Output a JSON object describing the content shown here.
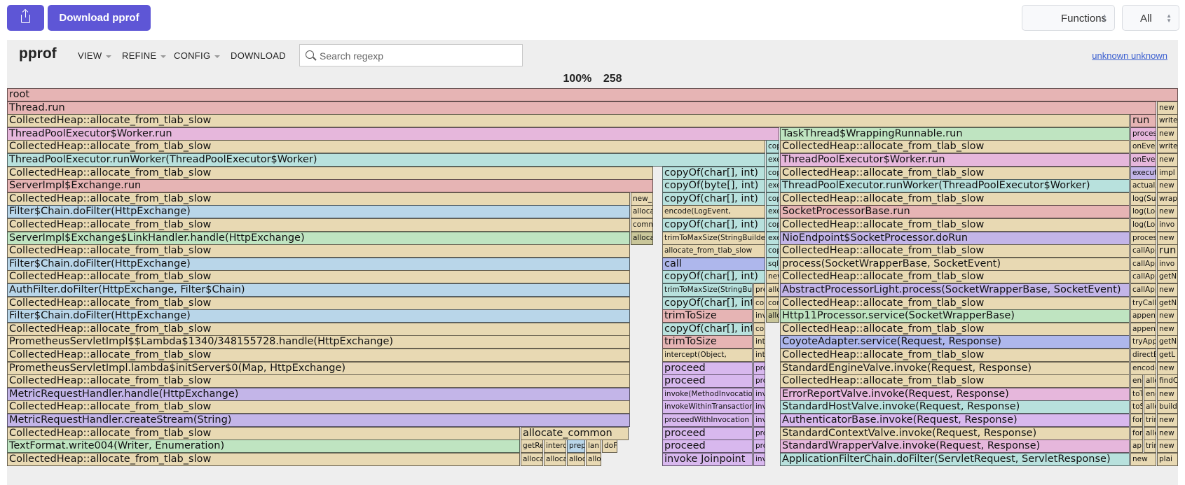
{
  "toolbar": {
    "download_label": "Download pprof",
    "view_select": "Functions",
    "scope_select": "All"
  },
  "header": {
    "logo": "pprof",
    "menu": [
      "VIEW",
      "REFINE",
      "CONFIG",
      "DOWNLOAD"
    ],
    "search_placeholder": "Search regexp",
    "user": "unknown unknown"
  },
  "summary": {
    "percent": "100%",
    "total": "258"
  },
  "flame": [
    [
      "root"
    ],
    [
      "Thread.run",
      "new"
    ],
    [
      "CollectedHeap::allocate_from_tlab_slow",
      "run",
      "write"
    ],
    [
      "ThreadPoolExecutor$Worker.run",
      "TaskThread$WrappingRunnable.run",
      "process",
      "new"
    ],
    [
      "CollectedHeap::allocate_from_tlab_slow",
      "cop",
      "CollectedHeap::allocate_from_tlab_slow",
      "onEvent",
      "write"
    ],
    [
      "ThreadPoolExecutor.runWorker(ThreadPoolExecutor$Worker)",
      "exe",
      "ThreadPoolExecutor$Worker.run",
      "onEvent",
      "new"
    ],
    [
      "CollectedHeap::allocate_from_tlab_slow",
      "copyOf(char[], int)",
      "cop",
      "CollectedHeap::allocate_from_tlab_slow",
      "execute",
      "impl"
    ],
    [
      "ServerImpl$Exchange.run",
      "copyOf(byte[], int)",
      "exe",
      "ThreadPoolExecutor.runWorker(ThreadPoolExecutor$Worker)",
      "actualAppend",
      "new"
    ],
    [
      "CollectedHeap::allocate_from_tlab_slow",
      "new_",
      "copyOf(char[], int)",
      "cop",
      "CollectedHeap::allocate_from_tlab_slow",
      "log(Supplier)",
      "wrap"
    ],
    [
      "Filter$Chain.doFilter(HttpExchange)",
      "allocate",
      "encode(LogEvent,",
      "exe",
      "SocketProcessorBase.run",
      "log(Logger)",
      "new"
    ],
    [
      "CollectedHeap::allocate_from_tlab_slow",
      "comm",
      "copyOf(char[], int)",
      "cop",
      "CollectedHeap::allocate_from_tlab_slow",
      "log(Logger)",
      "invo"
    ],
    [
      "ServerImpl$Exchange$LinkHandler.handle(HttpExchange)",
      "allocate",
      "trimToMaxSize(StringBuilder)",
      "exe",
      "NioEndpoint$SocketProcessor.doRun",
      "process",
      "new"
    ],
    [
      "CollectedHeap::allocate_from_tlab_slow",
      "allocate_from_tlab_slow",
      "cop",
      "CollectedHeap::allocate_from_tlab_slow",
      "callAppender",
      "run"
    ],
    [
      "Filter$Chain.doFilter(HttpExchange)",
      "call",
      "sql",
      "process(SocketWrapperBase, SocketEvent)",
      "callAppender",
      "invo"
    ],
    [
      "CollectedHeap::allocate_from_tlab_slow",
      "copyOf(char[], int)",
      "new",
      "CollectedHeap::allocate_from_tlab_slow",
      "callAppender",
      "getN"
    ],
    [
      "AuthFilter.doFilter(HttpExchange, Filter$Chain)",
      "trimToMaxSize(StringBuilder)",
      "pre",
      "allo",
      "AbstractProcessorLight.process(SocketWrapperBase, SocketEvent)",
      "callAppender",
      "new"
    ],
    [
      "CollectedHeap::allocate_from_tlab_slow",
      "copyOf(char[], int)",
      "cop",
      "com",
      "CollectedHeap::allocate_from_tlab_slow",
      "tryCallAppender",
      "getN"
    ],
    [
      "Filter$Chain.doFilter(HttpExchange)",
      "trimToSize",
      "inv",
      "allo",
      "Http11Processor.service(SocketWrapperBase)",
      "append",
      "new"
    ],
    [
      "CollectedHeap::allocate_from_tlab_slow",
      "copyOf(char[], int)",
      "cop",
      "CollectedHeap::allocate_from_tlab_slow",
      "append",
      "new"
    ],
    [
      "PrometheusServletImpl$$Lambda$1340/348155728.handle(HttpExchange)",
      "trimToSize",
      "inte",
      "CoyoteAdapter.service(Request, Response)",
      "tryAppend",
      "getN"
    ],
    [
      "CollectedHeap::allocate_from_tlab_slow",
      "intercept(Object,",
      "inte",
      "CollectedHeap::allocate_from_tlab_slow",
      "directEncode",
      "getL"
    ],
    [
      "PrometheusServletImpl.lambda$initServer$0(Map, HttpExchange)",
      "proceed",
      "pro",
      "StandardEngineValve.invoke(Request, Response)",
      "encode",
      "new"
    ],
    [
      "CollectedHeap::allocate_from_tlab_slow",
      "proceed",
      "pro",
      "CollectedHeap::allocate_from_tlab_slow",
      "enc",
      "allo",
      "findC"
    ],
    [
      "MetricRequestHandler.handle(HttpExchange)",
      "invoke(MethodInvocation)",
      "inv",
      "ErrorReportValve.invoke(Request, Response)",
      "toText",
      "enc",
      "new"
    ],
    [
      "CollectedHeap::allocate_from_tlab_slow",
      "invokeWithinTransaction",
      "inv",
      "StandardHostValve.invoke(Request, Response)",
      "toString",
      "allo",
      "build"
    ],
    [
      "MetricRequestHandler.createStream(String)",
      "proceedWithInvocation",
      "inv",
      "AuthenticatorBase.invoke(Request, Response)",
      "format",
      "trim",
      "new"
    ],
    [
      "CollectedHeap::allocate_from_tlab_slow",
      "allocate_common",
      "proceed",
      "pro",
      "StandardContextValve.invoke(Request, Response)",
      "format",
      "allo",
      "new"
    ],
    [
      "TextFormat.write004(Writer, Enumeration)",
      "getRe",
      "interc",
      "prep",
      "lan",
      "doF",
      "proceed",
      "pro",
      "StandardWrapperValve.invoke(Request, Response)",
      "app",
      "trim",
      "new"
    ],
    [
      "CollectedHeap::allocate_from_tlab_slow",
      "alloca",
      "alloca",
      "alloca",
      "allo",
      "invoke Joinpoint",
      "inv",
      "ApplicationFilterChain.doFilter(ServletRequest, ServletResponse)",
      "new",
      "plai"
    ]
  ]
}
